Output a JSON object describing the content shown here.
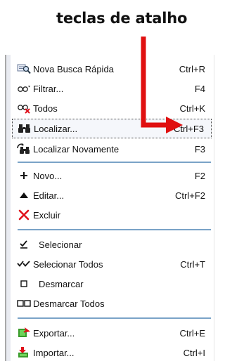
{
  "annotation": {
    "title": "teclas de atalho"
  },
  "colors": {
    "arrow": "#e01010",
    "separator": "#7aa3c7",
    "accent_green": "#3a9b2b",
    "accent_red": "#e0101a"
  },
  "menu": {
    "items": [
      {
        "label": "Nova Busca Rápida",
        "shortcut": "Ctrl+R",
        "icon": "quick-search-icon"
      },
      {
        "label": "Filtrar...",
        "shortcut": "F4",
        "icon": "filter-icon"
      },
      {
        "label": "Todos",
        "shortcut": "Ctrl+K",
        "icon": "clear-filter-icon"
      },
      {
        "label": "Localizar...",
        "shortcut": "Ctrl+F3",
        "icon": "binoculars-icon",
        "selected": true
      },
      {
        "label": "Localizar Novamente",
        "shortcut": "F3",
        "icon": "find-again-icon"
      },
      {
        "label": "Novo...",
        "shortcut": "F2",
        "icon": "plus-icon"
      },
      {
        "label": "Editar...",
        "shortcut": "Ctrl+F2",
        "icon": "triangle-up-icon"
      },
      {
        "label": "Excluir",
        "shortcut": "",
        "icon": "delete-x-icon"
      },
      {
        "label": "Selecionar",
        "shortcut": "",
        "icon": "select-check-icon"
      },
      {
        "label": "Selecionar Todos",
        "shortcut": "Ctrl+T",
        "icon": "double-check-icon"
      },
      {
        "label": "Desmarcar",
        "shortcut": "",
        "icon": "empty-square-icon"
      },
      {
        "label": "Desmarcar Todos",
        "shortcut": "",
        "icon": "double-square-icon"
      },
      {
        "label": "Exportar...",
        "shortcut": "Ctrl+E",
        "icon": "export-icon"
      },
      {
        "label": "Importar...",
        "shortcut": "Ctrl+I",
        "icon": "import-icon"
      }
    ]
  }
}
